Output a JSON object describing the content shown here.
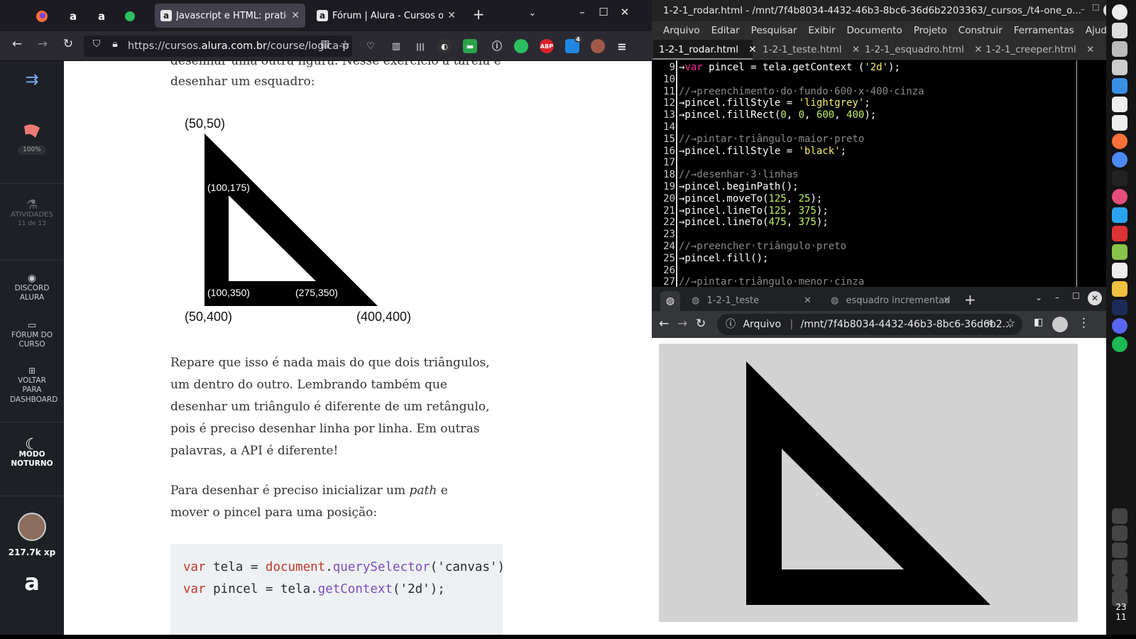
{
  "firefox": {
    "tabs": [
      {
        "label": "Javascript e HTML: pratique"
      },
      {
        "label": "Fórum | Alura - Cursos onlin"
      }
    ],
    "url_prefix": "https://cursos.",
    "url_domain": "alura.com.br",
    "url_suffix": "/course/logica-p",
    "abp_label": "ABP",
    "ext_badge": "4"
  },
  "sidebar": {
    "progress": "100%",
    "activities_label": "ATIVIDADES",
    "activities_count": "11 de 13",
    "discord_label": "DISCORD ALURA",
    "forum_label": "FÓRUM DO CURSO",
    "dashboard_label": "VOLTAR PARA DASHBOARD",
    "night_label": "MODO NOTURNO",
    "xp": "217.7k xp",
    "logo": "a"
  },
  "article": {
    "intro_line1": "desenhar uma outra figura. Nesse exercício a tarefa é",
    "intro_line2": "desenhar um esquadro:",
    "figure_labels": {
      "top": "(50,50)",
      "inner_top": "(100,175)",
      "inner_bl": "(100,350)",
      "inner_br": "(275,350)",
      "bl": "(50,400)",
      "br": "(400,400)"
    },
    "para1": "Repare que isso é nada mais do que dois triângulos, um dentro do outro. Lembrando também que desenhar um triângulo é diferente de um retângulo, pois é preciso desenhar linha por linha. Em outras palavras, a API é diferente!",
    "para2_a": "Para desenhar é preciso inicializar um ",
    "para2_em": "path",
    "para2_b": " e mover o pincel para uma posição:",
    "code_line1": {
      "kw": "var",
      "a": " tela = ",
      "obj": "document",
      "dot": ".",
      "fn": "querySelector",
      "b": "('canvas')"
    },
    "code_line2": {
      "kw": "var",
      "a": " pincel = tela.",
      "fn": "getContext",
      "b": "('2d');"
    }
  },
  "gedit": {
    "title": "1-2-1_rodar.html - /mnt/7f4b8034-4432-46b3-8bc6-36d6b2203363/_cursos_/t4-one_o...",
    "menu": [
      "Arquivo",
      "Editar",
      "Pesquisar",
      "Exibir",
      "Documento",
      "Projeto",
      "Construir",
      "Ferramentas",
      "Ajuda"
    ],
    "tabs": [
      "1-2-1_rodar.html",
      "1-2-1_teste.html",
      "1-2-1_esquadro.html",
      "1-2-1_creeper.html"
    ],
    "lines": [
      {
        "n": "9",
        "parts": [
          [
            "",
            "→"
          ],
          [
            "sv",
            "var"
          ],
          [
            "",
            " pincel = tela.getContext ("
          ],
          [
            "ss",
            "'2d'"
          ],
          [
            "",
            ");"
          ]
        ]
      },
      {
        "n": "10",
        "parts": []
      },
      {
        "n": "11",
        "parts": [
          [
            "cm",
            "//→preenchimento·do·fundo·600·x·400·cinza"
          ]
        ]
      },
      {
        "n": "12",
        "parts": [
          [
            "",
            "→pincel.fillStyle = "
          ],
          [
            "ss",
            "'lightgrey'"
          ],
          [
            "",
            ";"
          ]
        ]
      },
      {
        "n": "13",
        "parts": [
          [
            "",
            "→pincel.fillRect("
          ],
          [
            "sn",
            "0"
          ],
          [
            "",
            ", "
          ],
          [
            "sn",
            "0"
          ],
          [
            "",
            ", "
          ],
          [
            "sn",
            "600"
          ],
          [
            "",
            ", "
          ],
          [
            "sn",
            "400"
          ],
          [
            "",
            ");"
          ]
        ]
      },
      {
        "n": "14",
        "parts": []
      },
      {
        "n": "15",
        "parts": [
          [
            "cm",
            "//→pintar·triângulo·maior·preto"
          ]
        ]
      },
      {
        "n": "16",
        "parts": [
          [
            "",
            "→pincel.fillStyle = "
          ],
          [
            "ss",
            "'black'"
          ],
          [
            "",
            ";"
          ]
        ]
      },
      {
        "n": "17",
        "parts": []
      },
      {
        "n": "18",
        "parts": [
          [
            "cm",
            "//→desenhar·3·linhas"
          ]
        ]
      },
      {
        "n": "19",
        "parts": [
          [
            "",
            "→pincel.beginPath();"
          ]
        ]
      },
      {
        "n": "20",
        "parts": [
          [
            "",
            "→pincel.moveTo("
          ],
          [
            "sn",
            "125"
          ],
          [
            "",
            ", "
          ],
          [
            "sn",
            "25"
          ],
          [
            "",
            ");"
          ]
        ]
      },
      {
        "n": "21",
        "parts": [
          [
            "",
            "→pincel.lineTo("
          ],
          [
            "sn",
            "125"
          ],
          [
            "",
            ", "
          ],
          [
            "sn",
            "375"
          ],
          [
            "",
            ");"
          ]
        ]
      },
      {
        "n": "22",
        "parts": [
          [
            "",
            "→pincel.lineTo("
          ],
          [
            "sn",
            "475"
          ],
          [
            "",
            ", "
          ],
          [
            "sn",
            "375"
          ],
          [
            "",
            ");"
          ]
        ]
      },
      {
        "n": "23",
        "parts": []
      },
      {
        "n": "24",
        "parts": [
          [
            "cm",
            "//→preencher·triângulo·preto"
          ]
        ]
      },
      {
        "n": "25",
        "parts": [
          [
            "",
            "→pincel.fill();"
          ]
        ]
      },
      {
        "n": "26",
        "parts": []
      },
      {
        "n": "27",
        "parts": [
          [
            "cm",
            "//→pintar·triângulo·menor·cinza"
          ]
        ]
      }
    ]
  },
  "chrome": {
    "tabs": [
      "1-2-1_teste",
      "esquadro incrementad"
    ],
    "origin_label": "Arquivo",
    "path": "/mnt/7f4b8034-4432-46b3-8bc6-36d6b2..."
  },
  "dock": {
    "clock_h": "23",
    "clock_m": "11"
  }
}
